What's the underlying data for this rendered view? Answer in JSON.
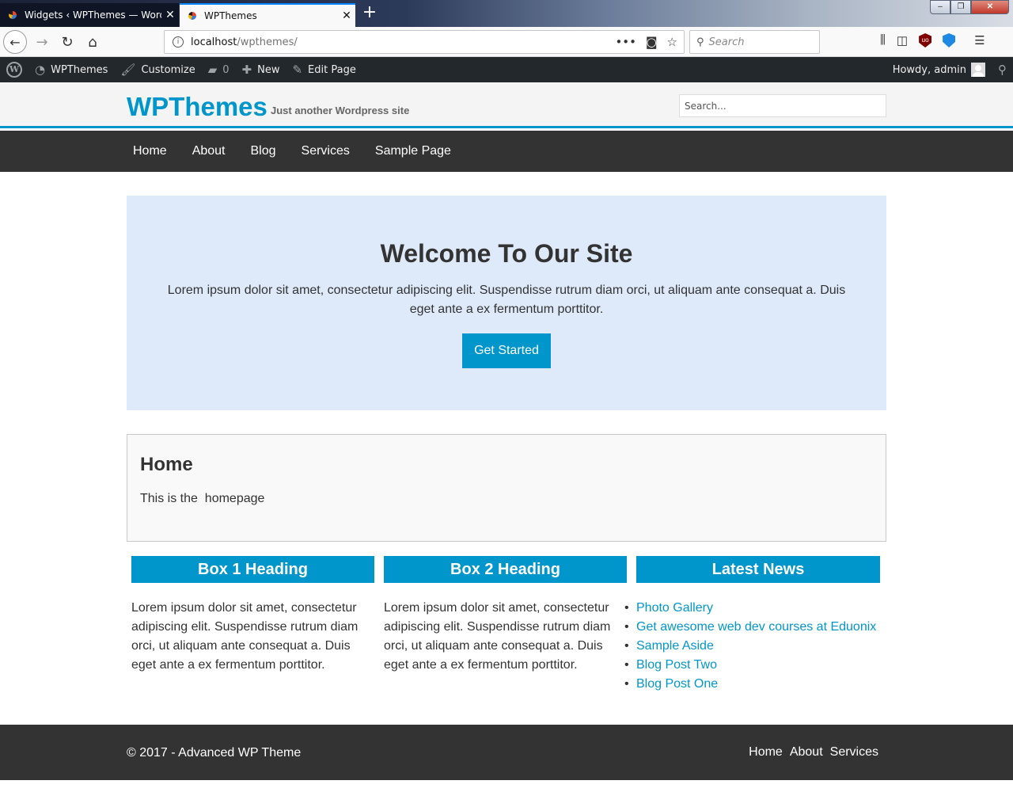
{
  "browser": {
    "tabs": [
      {
        "title": "Widgets ‹ WPThemes — WordP",
        "close": "✕",
        "active": false
      },
      {
        "title": "WPThemes",
        "close": "✕",
        "active": true
      }
    ],
    "new_tab": "+",
    "url": {
      "host": "localhost",
      "path": "/wpthemes/"
    },
    "search_placeholder": "Search"
  },
  "admin_bar": {
    "site_name": "WPThemes",
    "customize": "Customize",
    "comments_count": "0",
    "new": "New",
    "edit_page": "Edit Page",
    "greeting": "Howdy, admin"
  },
  "site": {
    "title": "WPThemes",
    "tagline": "Just another Wordpress site",
    "search_placeholder": "Search...",
    "nav": [
      "Home",
      "About",
      "Blog",
      "Services",
      "Sample Page"
    ]
  },
  "showcase": {
    "heading": "Welcome To Our Site",
    "text": "Lorem ipsum dolor sit amet, consectetur adipiscing elit. Suspendisse rutrum diam orci, ut aliquam ante consequat a. Duis eget ante a ex fermentum porttitor.",
    "button": "Get Started"
  },
  "page": {
    "heading": "Home",
    "body": "This is the  homepage"
  },
  "boxes": [
    {
      "heading": "Box 1 Heading",
      "text": "Lorem ipsum dolor sit amet, consectetur adipiscing elit. Suspendisse rutrum diam orci, ut aliquam ante consequat a. Duis eget ante a ex fermentum porttitor."
    },
    {
      "heading": "Box 2 Heading",
      "text": "Lorem ipsum dolor sit amet, consectetur adipiscing elit. Suspendisse rutrum diam orci, ut aliquam ante consequat a. Duis eget ante a ex fermentum porttitor."
    },
    {
      "heading": "Latest News",
      "links": [
        "Photo Gallery",
        "Get awesome web dev courses at Eduonix",
        "Sample Aside",
        "Blog Post Two",
        "Blog Post One"
      ]
    }
  ],
  "footer": {
    "copyright": "© 2017 - Advanced WP Theme",
    "nav": [
      "Home",
      "About",
      "Services"
    ]
  },
  "colors": {
    "accent": "#0096cc",
    "dark": "#333333",
    "admin_bar": "#23282d",
    "showcase_bg": "#deeaf9"
  }
}
